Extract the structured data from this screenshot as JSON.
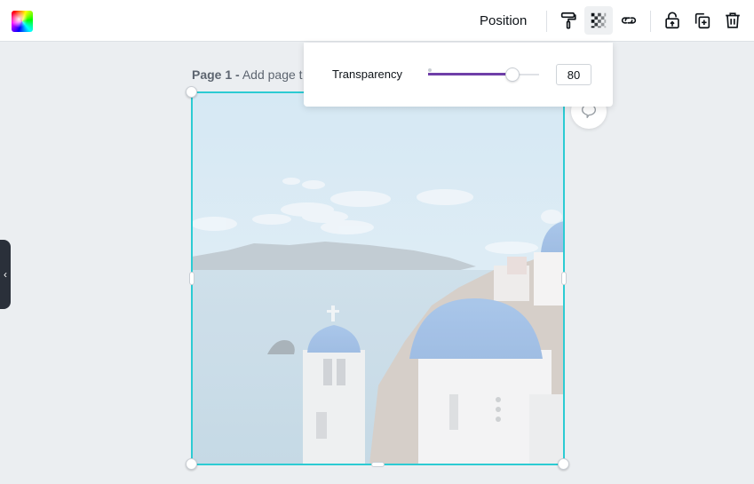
{
  "toolbar": {
    "color_swatch": "color-picker",
    "position_label": "Position",
    "icons": [
      "paint-roller-icon",
      "transparency-icon",
      "link-icon",
      "unlock-icon",
      "duplicate-icon",
      "trash-icon"
    ],
    "active_icon": "transparency-icon"
  },
  "page": {
    "label_prefix": "Page 1 -",
    "label_placeholder": "Add page t"
  },
  "popover": {
    "label": "Transparency",
    "value": "80",
    "slider_percent": 80,
    "accent_color": "#6f3ea8"
  },
  "selection": {
    "border_color": "#2ccbd3"
  },
  "sidebar": {
    "collapse_glyph": "‹"
  }
}
